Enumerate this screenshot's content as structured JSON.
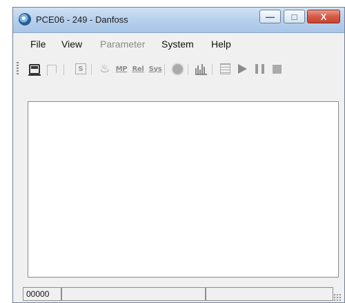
{
  "window": {
    "title": "PCE06 - 249 - Danfoss",
    "controls": {
      "minimize": "—",
      "maximize": "□",
      "close": "X"
    }
  },
  "menu": {
    "items": [
      {
        "label": "File",
        "enabled": true
      },
      {
        "label": "View",
        "enabled": true
      },
      {
        "label": "Parameter",
        "enabled": false
      },
      {
        "label": "System",
        "enabled": true
      },
      {
        "label": "Help",
        "enabled": true
      }
    ]
  },
  "toolbar": {
    "s_label": "S",
    "mp_label": "MP",
    "rel_label": "Rel",
    "sys_label": "Sys"
  },
  "status": {
    "code": "00000",
    "pane_2": "",
    "pane_3": ""
  },
  "icons": {
    "app": "app-icon",
    "connect": "train-icon",
    "disconnect": "flag-icon",
    "s": "s-icon",
    "mask": "mask-icon",
    "mp": "mp-icon",
    "rel": "rel-icon",
    "sys": "sys-icon",
    "sun": "sun-icon",
    "bars": "bar-chart-icon",
    "calc": "calculator-icon",
    "play": "play-icon",
    "pause": "pause-icon",
    "stop": "stop-icon"
  }
}
